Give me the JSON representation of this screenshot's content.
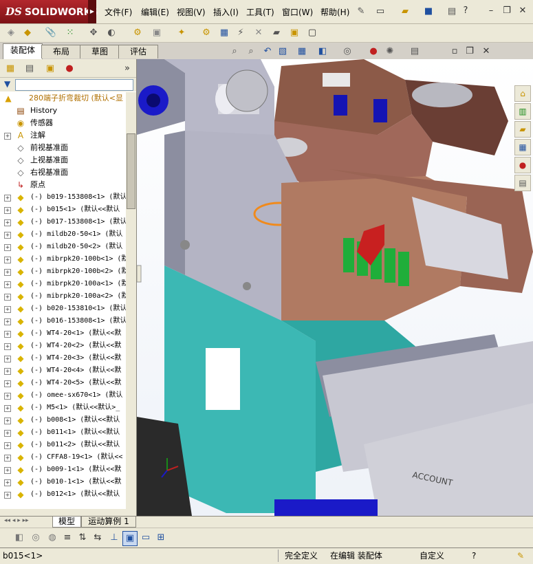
{
  "app": {
    "logo_prefix": "DS",
    "logo_text": "SOLIDWORKS"
  },
  "menu": [
    "文件(F)",
    "编辑(E)",
    "视图(V)",
    "插入(I)",
    "工具(T)",
    "窗口(W)",
    "帮助(H)"
  ],
  "window_buttons": {
    "minimize": "–",
    "restore": "❐",
    "close": "✕",
    "help": "?"
  },
  "cm_tabs": [
    "装配体",
    "布局",
    "草图",
    "评估"
  ],
  "feature_tree": {
    "root": "280端子折弯裁切  (默认<显",
    "features": [
      "History",
      "传感器",
      "注解",
      "前视基准面",
      "上视基准面",
      "右视基准面",
      "原点"
    ],
    "components": [
      "(-) b019-153808<1> (默认",
      "(-) b015<1> (默认<<默认",
      "(-) b017-153808<1> (默认",
      "(-) mildb20-50<1> (默认",
      "(-) mildb20-50<2> (默认",
      "(-) mibrpk20-100b<1> (默",
      "(-) mibrpk20-100b<2> (默",
      "(-) mibrpk20-100a<1> (默",
      "(-) mibrpk20-100a<2> (默",
      "(-) b020-153810<1> (默认",
      "(-) b016-153808<1> (默认",
      "(-) WT4-20<1> (默认<<默",
      "(-) WT4-20<2> (默认<<默",
      "(-) WT4-20<3> (默认<<默",
      "(-) WT4-20<4> (默认<<默",
      "(-) WT4-20<5> (默认<<默",
      "(-) omee-sx670<1> (默认",
      "(-) M5<1> (默认<<默认>_",
      "(-) b008<1> (默认<<默认",
      "(-) b011<1> (默认<<默认",
      "(-) b011<2> (默认<<默认",
      "(-) CFFA8-19<1> (默认<<",
      "(-) b009-1<1> (默认<<默",
      "(-) b010-1<1> (默认<<默",
      "(-) b012<1> (默认<<默认"
    ]
  },
  "bottom_tabs": [
    "模型",
    "运动算例 1"
  ],
  "status": {
    "selection": "b015<1>",
    "definition": "完全定义",
    "mode": "在编辑 装配体",
    "custom": "自定义",
    "help": "?"
  },
  "viewport_label": "ACCOUNT",
  "colors": {
    "accent": "#b3272d",
    "teal": "#3cb8b4",
    "copper": "#b07a62",
    "dark_copper": "#7a4a3c",
    "green": "#1fae3a",
    "orange_marker": "#f08a1c"
  }
}
